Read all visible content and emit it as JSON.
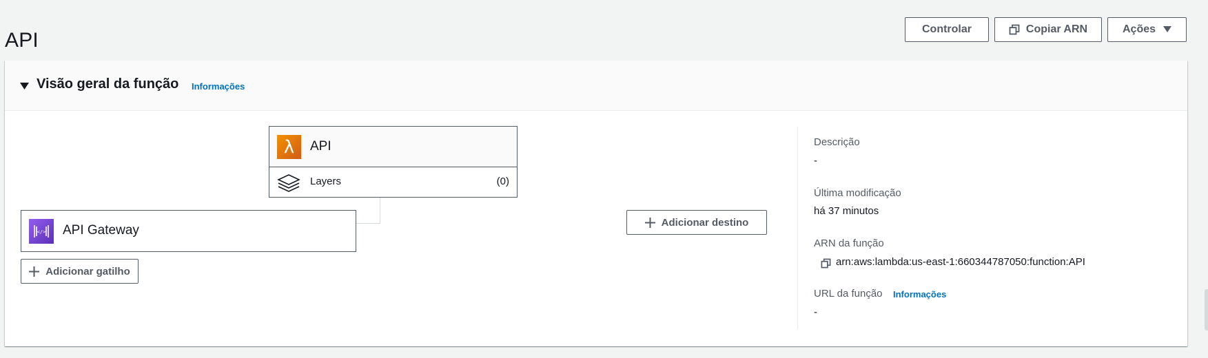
{
  "page": {
    "title": "API"
  },
  "header_actions": {
    "controlar_label": "Controlar",
    "copiar_arn_label": "Copiar ARN",
    "acoes_label": "Ações"
  },
  "overview": {
    "title": "Visão geral da função",
    "info_link": "Informações",
    "function": {
      "name": "API",
      "layers_label": "Layers",
      "layers_count": "(0)"
    },
    "trigger": {
      "name": "API Gateway",
      "add_trigger_label": "Adicionar gatilho"
    },
    "destination": {
      "add_destination_label": "Adicionar destino"
    },
    "details": {
      "description_label": "Descrição",
      "description_value": "-",
      "last_modified_label": "Última modificação",
      "last_modified_value": "há 37 minutos",
      "arn_label": "ARN da função",
      "arn_value": "arn:aws:lambda:us-east-1:660344787050:function:API",
      "url_label": "URL da função",
      "url_info_link": "Informações",
      "url_value": "-"
    }
  },
  "icons": {
    "copy": "copy-icon",
    "caret_down": "caret-down-icon",
    "plus": "plus-icon",
    "lambda": "lambda-icon",
    "layers": "layers-icon",
    "api_gateway": "api-gateway-icon"
  },
  "colors": {
    "background": "#f2f3f3",
    "link": "#0073bb",
    "button_text": "#545b64",
    "lambda_orange": "#e07b17",
    "api_gateway_purple": "#7b45d6"
  }
}
